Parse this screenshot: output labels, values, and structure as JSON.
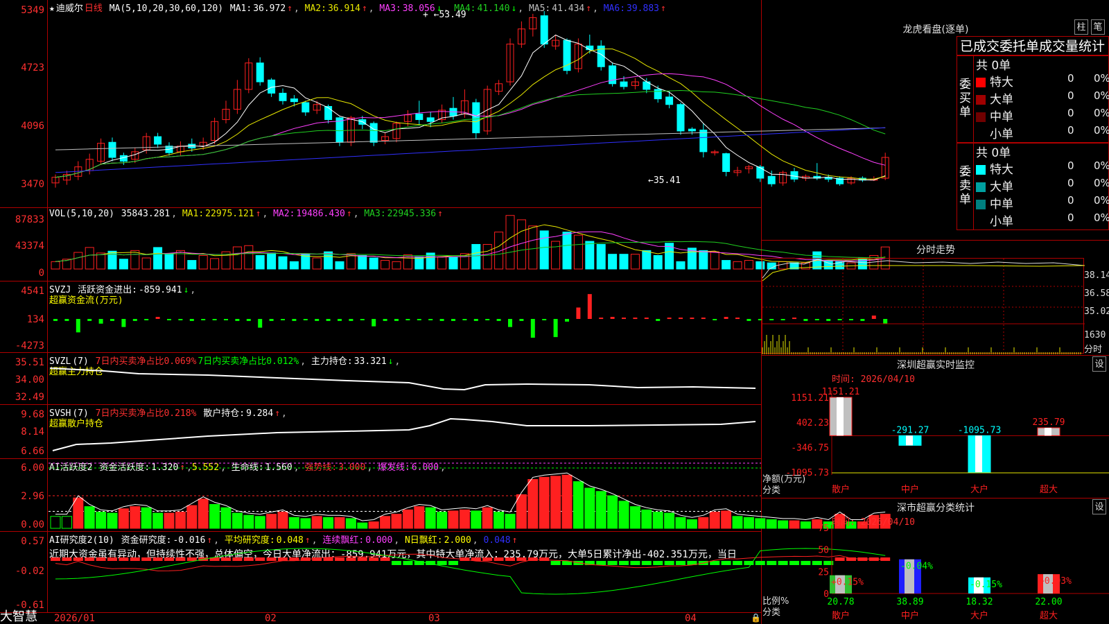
{
  "app": {
    "name": "大智慧"
  },
  "colors": {
    "up": "#ff2020",
    "down": "#00ffff",
    "ma1": "#ffffff",
    "ma2": "#e8e800",
    "ma3": "#ff40ff",
    "ma4": "#20d020",
    "ma5": "#c0c0c0",
    "ma6": "#3030ff",
    "frame": "#b00000",
    "green": "#00ff00",
    "yellow": "#ffff00"
  },
  "kline": {
    "stock_name": "迪威尔",
    "period": "日线",
    "ma_spec": "MA(5,10,20,30,60,120)",
    "ma": [
      {
        "label": "MA1:",
        "value": "36.972",
        "arrow": "↑"
      },
      {
        "label": "MA2:",
        "value": "36.914",
        "arrow": "↑"
      },
      {
        "label": "MA3:",
        "value": "38.056",
        "arrow": "↓"
      },
      {
        "label": "MA4:",
        "value": "41.140",
        "arrow": "↓"
      },
      {
        "label": "MA5:",
        "value": "41.434",
        "arrow": "↑"
      },
      {
        "label": "MA6:",
        "value": "39.883",
        "arrow": "↑"
      }
    ],
    "y_labels": [
      "5349",
      "4723",
      "4096",
      "3470"
    ],
    "high_mark": "53.49",
    "low_mark": "←35.41",
    "candles": [
      [
        3530,
        3590,
        3480,
        3620
      ],
      [
        3560,
        3620,
        3510,
        3660
      ],
      [
        3600,
        3700,
        3560,
        3760
      ],
      [
        3660,
        3780,
        3620,
        3840
      ],
      [
        3760,
        3950,
        3720,
        4000
      ],
      [
        3960,
        3800,
        3760,
        4010
      ],
      [
        3820,
        3760,
        3720,
        3850
      ],
      [
        3780,
        3860,
        3740,
        3900
      ],
      [
        3880,
        4020,
        3840,
        4060
      ],
      [
        4020,
        3940,
        3900,
        4060
      ],
      [
        3920,
        3850,
        3820,
        3960
      ],
      [
        3860,
        3920,
        3820,
        3970
      ],
      [
        3940,
        3900,
        3860,
        4000
      ],
      [
        3920,
        3960,
        3880,
        4010
      ],
      [
        3980,
        4180,
        3940,
        4220
      ],
      [
        4200,
        4310,
        4160,
        4400
      ],
      [
        4310,
        4520,
        4260,
        4620
      ],
      [
        4520,
        4800,
        4480,
        4850
      ],
      [
        4800,
        4600,
        4560,
        4860
      ],
      [
        4620,
        4480,
        4440,
        4640
      ],
      [
        4480,
        4400,
        4360,
        4530
      ],
      [
        4420,
        4390,
        4340,
        4460
      ],
      [
        4380,
        4280,
        4240,
        4400
      ],
      [
        4300,
        4360,
        4260,
        4400
      ],
      [
        4340,
        4200,
        4160,
        4360
      ],
      [
        4220,
        3960,
        3920,
        4230
      ],
      [
        3960,
        4220,
        3920,
        4240
      ],
      [
        4200,
        4150,
        4100,
        4240
      ],
      [
        4160,
        3960,
        3920,
        4180
      ],
      [
        3980,
        4020,
        3940,
        4060
      ],
      [
        4000,
        4160,
        3960,
        4180
      ],
      [
        4180,
        4250,
        4130,
        4300
      ],
      [
        4260,
        4200,
        4140,
        4400
      ],
      [
        4220,
        4180,
        4120,
        4280
      ],
      [
        4200,
        4300,
        4160,
        4360
      ],
      [
        4320,
        4240,
        4200,
        4440
      ],
      [
        4260,
        4400,
        4220,
        4520
      ],
      [
        4380,
        4060,
        4000,
        4420
      ],
      [
        4080,
        4520,
        4040,
        4560
      ],
      [
        4500,
        4580,
        4460,
        4620
      ],
      [
        4600,
        5000,
        4560,
        5060
      ],
      [
        5000,
        5160,
        4960,
        5240
      ],
      [
        5160,
        5280,
        5080,
        5320
      ],
      [
        5300,
        5000,
        4960,
        5349
      ],
      [
        4980,
        5040,
        4940,
        5100
      ],
      [
        5040,
        4720,
        4680,
        5060
      ],
      [
        4740,
        5000,
        4700,
        5060
      ],
      [
        4980,
        4940,
        4900,
        5100
      ],
      [
        4980,
        4760,
        4720,
        5040
      ],
      [
        4770,
        4580,
        4550,
        4800
      ],
      [
        4600,
        4550,
        4520,
        4660
      ],
      [
        4560,
        4600,
        4520,
        4640
      ],
      [
        4600,
        4520,
        4480,
        4640
      ],
      [
        4520,
        4420,
        4380,
        4560
      ],
      [
        4440,
        4360,
        4320,
        4500
      ],
      [
        4360,
        4080,
        4040,
        4380
      ],
      [
        4100,
        4080,
        4040,
        4120
      ],
      [
        4090,
        3860,
        3800,
        4160
      ],
      [
        3860,
        3860,
        3820,
        3880
      ],
      [
        3840,
        3650,
        3600,
        3850
      ],
      [
        3640,
        3660,
        3600,
        3700
      ],
      [
        3680,
        3700,
        3630,
        3720
      ],
      [
        3700,
        3580,
        3540,
        3720
      ],
      [
        3600,
        3520,
        3490,
        3660
      ],
      [
        3530,
        3640,
        3500,
        3660
      ],
      [
        3650,
        3570,
        3540,
        3690
      ],
      [
        3580,
        3600,
        3550,
        3620
      ],
      [
        3600,
        3580,
        3560,
        3740
      ],
      [
        3590,
        3570,
        3540,
        3620
      ],
      [
        3580,
        3520,
        3500,
        3600
      ],
      [
        3530,
        3580,
        3510,
        3600
      ],
      [
        3580,
        3560,
        3540,
        3600
      ],
      [
        3570,
        3570,
        3550,
        3600
      ],
      [
        3580,
        3800,
        3560,
        3850
      ]
    ]
  },
  "vol": {
    "spec": "VOL(5,10,20)",
    "v": "35843.281",
    "ma": [
      {
        "label": "MA1:",
        "value": "22975.121",
        "arrow": "↑"
      },
      {
        "label": "MA2:",
        "value": "19486.430",
        "arrow": "↑"
      },
      {
        "label": "MA3:",
        "value": "22945.336",
        "arrow": "↑"
      }
    ],
    "y_labels": [
      "87833",
      "43374",
      "0"
    ],
    "bars": [
      12000,
      16000,
      27000,
      35000,
      26000,
      29000,
      16000,
      30000,
      18000,
      35000,
      25000,
      30000,
      14000,
      22000,
      17000,
      28000,
      36000,
      38000,
      22000,
      26000,
      20000,
      12000,
      25000,
      18000,
      28000,
      12000,
      25000,
      22000,
      18000,
      14000,
      12000,
      23000,
      20000,
      26000,
      20000,
      19000,
      25000,
      40000,
      40000,
      60000,
      87000,
      80000,
      70000,
      62000,
      45000,
      60000,
      55000,
      45000,
      40000,
      24000,
      24000,
      24000,
      30000,
      22000,
      42000,
      12000,
      34000,
      30000,
      28000,
      14000,
      12000,
      14000,
      12000,
      10000,
      12000,
      10000,
      10000,
      28000,
      14000,
      12000,
      10000,
      18000,
      22000,
      35843
    ]
  },
  "svzj": {
    "name": "SVZJ",
    "label": "活跃资金进出:",
    "value": "-859.941",
    "arrow": "↓",
    "sub": "超赢资金流(万元)",
    "y_labels": [
      "4541",
      "134",
      "-4273"
    ],
    "bars": [
      -300,
      -300,
      -2000,
      -300,
      -700,
      -300,
      -1200,
      -300,
      -200,
      300,
      -200,
      -200,
      -300,
      -200,
      -200,
      -200,
      -300,
      -300,
      -1300,
      -300,
      -200,
      -300,
      -200,
      -300,
      -300,
      -300,
      -300,
      -200,
      -1100,
      -300,
      -300,
      -200,
      -200,
      -200,
      -300,
      -300,
      -200,
      -300,
      -200,
      -300,
      -1200,
      -300,
      -2800,
      -200,
      -2700,
      -400,
      1700,
      3700,
      200,
      300,
      200,
      200,
      200,
      -300,
      200,
      200,
      200,
      200,
      -200,
      300,
      200,
      -300,
      -200,
      -200,
      -200,
      200,
      -300,
      -200,
      -300,
      -200,
      -200,
      -300,
      500,
      -700
    ]
  },
  "svzl": {
    "name": "SVZL",
    "param": "(7)",
    "red_text": "7日内买卖净占比0.069%",
    "green_text": "7日内买卖净占比0.012%",
    "label": "主力持仓:",
    "value": "33.321",
    "arrow": "↓",
    "sub": "超赢主力持仓",
    "y_labels": [
      "35.51",
      "34.00",
      "32.49"
    ]
  },
  "svsh": {
    "name": "SVSH",
    "param": "(7)",
    "red_text": "7日内买卖净占比0.218%",
    "label": "散户持仓:",
    "value": "9.284",
    "arrow": "↑",
    "sub": "超赢散户持仓",
    "y_labels": [
      "9.68",
      "8.14",
      "6.66"
    ]
  },
  "aihy": {
    "name": "AI活跃度2",
    "label": "资金活跃度:",
    "value": "1.320",
    "arrow": "↑",
    "v2": "5.552",
    "life_label": "生命线:",
    "life": "1.560",
    "strong_label": "强势线:",
    "strong": "3.000",
    "burst_label": "爆发线:",
    "burst": "6.000",
    "y_labels": [
      "6.00",
      "2.96",
      "0.00"
    ],
    "bars": [
      1.1,
      1.1,
      2.8,
      2.0,
      1.5,
      1.4,
      1.8,
      2.0,
      1.9,
      1.4,
      1.4,
      1.5,
      2.1,
      2.7,
      2.2,
      1.9,
      1.4,
      1.2,
      1.1,
      1.3,
      1.5,
      1.0,
      0.9,
      1.1,
      1.0,
      1.0,
      0.9,
      0.5,
      0.6,
      1.1,
      1.3,
      1.7,
      2.0,
      1.9,
      1.5,
      1.6,
      1.7,
      1.6,
      1.9,
      1.5,
      1.3,
      3.1,
      4.5,
      4.7,
      4.8,
      4.9,
      4.3,
      3.7,
      3.4,
      3.0,
      2.5,
      2.0,
      1.7,
      1.5,
      1.4,
      1.0,
      0.8,
      1.0,
      1.5,
      1.6,
      1.1,
      1.0,
      0.9,
      0.8,
      0.7,
      0.7,
      0.6,
      0.8,
      0.6,
      1.3,
      0.6,
      0.6,
      1.2,
      1.3
    ]
  },
  "aiyj": {
    "name": "AI研究度2(10)",
    "label": "资金研究度:",
    "value": "-0.016",
    "arrow": "↑",
    "avg_label": "平均研究度:",
    "avg": "0.048",
    "arrow2": "↑",
    "red_label": "连续飘红:",
    "red": "0.000",
    "n_label": "N日飘红:",
    "n": "2.000",
    "n2": "0.048",
    "arrow3": "↑",
    "comment": "近期大资金虽有异动，但持续性不强，总体偏空，今日大单净流出：-859.941万元，其中特大单净流入：235.79万元，大单5日累计净出-402.351万元，当日",
    "y_labels": [
      "0.57",
      "-0.02",
      "-0.61"
    ]
  },
  "xaxis": {
    "labels": [
      "2026/01",
      "02",
      "03",
      "04"
    ]
  },
  "lhb": {
    "title": "龙虎看盘(逐单)",
    "btn1": "柱",
    "btn2": "笔",
    "heading": "已成交委托单成交量统计",
    "buy": {
      "side": "委买单",
      "total": "共 0单",
      "rows": [
        {
          "name": "特大",
          "n": "0",
          "p": "0%",
          "c": "#ff0000"
        },
        {
          "name": "大单",
          "n": "0",
          "p": "0%",
          "c": "#a00000"
        },
        {
          "name": "中单",
          "n": "0",
          "p": "0%",
          "c": "#700000"
        },
        {
          "name": "小单",
          "n": "0",
          "p": "0%",
          "c": ""
        }
      ]
    },
    "sell": {
      "side": "委卖单",
      "total": "共 0单",
      "rows": [
        {
          "name": "特大",
          "n": "0",
          "p": "0%",
          "c": "#00ffff"
        },
        {
          "name": "大单",
          "n": "0",
          "p": "0%",
          "c": "#00a0a0"
        },
        {
          "name": "中单",
          "n": "0",
          "p": "0%",
          "c": "#008080"
        },
        {
          "name": "小单",
          "n": "0",
          "p": "0%",
          "c": ""
        }
      ]
    }
  },
  "fenshi": {
    "title": "分时走势",
    "y_labels": [
      "38.14",
      "36.58",
      "35.02"
    ],
    "vol_label": "1630",
    "vol_unit": "分时"
  },
  "szcy": {
    "title": "深圳超赢实时监控",
    "btn": "设",
    "time": "时间: 2026/04/10",
    "y_labels": [
      "1151.21",
      "402.23",
      "-346.75",
      "-1095.73"
    ],
    "unit1": "净额(万元)",
    "unit2": "分类",
    "cats": [
      "散户",
      "中户",
      "大户",
      "超大"
    ],
    "values": [
      1151.21,
      -291.27,
      -1095.73,
      235.79
    ],
    "val_labels": [
      "1151.21",
      "-291.27",
      "-1095.73",
      "235.79"
    ]
  },
  "scfl": {
    "title": "深市超赢分类统计",
    "btn": "设",
    "time": "时间: 2026/04/10",
    "y_labels": [
      "75",
      "50",
      "25",
      "0"
    ],
    "unit1": "比例%",
    "unit2": "分类",
    "cats": [
      "散户",
      "中户",
      "大户",
      "超大"
    ],
    "values": [
      20.78,
      38.89,
      18.32,
      22.0
    ],
    "val_labels": [
      "20.78",
      "38.89",
      "18.32",
      "22.00"
    ],
    "deltas": [
      "+0.15%",
      "-0.04%",
      "-0.15%",
      "+0.03%"
    ]
  }
}
